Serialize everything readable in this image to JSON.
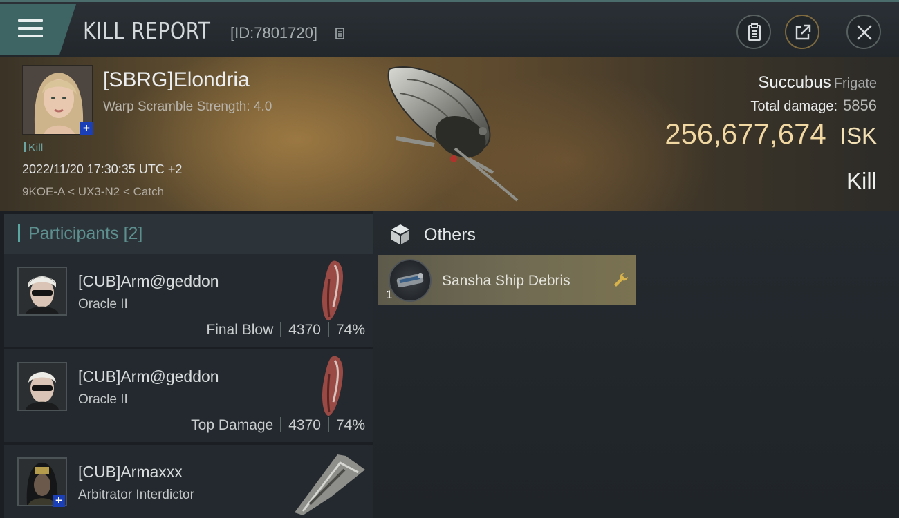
{
  "header": {
    "title": "KILL REPORT",
    "report_id": "[ID:7801720]",
    "menu_icon": "hamburger-menu-icon",
    "buttons": [
      "clipboard-icon",
      "share-icon",
      "close-icon"
    ]
  },
  "victim": {
    "name": "[SBRG]Elondria",
    "warp_scramble": "Warp Scramble Strength: 4.0",
    "kill_tag": "Kill",
    "datetime": "2022/11/20 17:30:35 UTC +2",
    "location": "9KOE-A < UX3-N2 < Catch",
    "ship_name": "Succubus",
    "ship_class": "Frigate",
    "total_damage_label": "Total damage:",
    "total_damage": "5856",
    "isk_value": "256,677,674",
    "isk_unit": "ISK",
    "result": "Kill"
  },
  "participants": {
    "label": "Participants",
    "count": "[2]",
    "rows": [
      {
        "name": "[CUB]Arm@geddon",
        "ship": "Oracle II",
        "role": "Final Blow",
        "damage": "4370",
        "percent": "74%"
      },
      {
        "name": "[CUB]Arm@geddon",
        "ship": "Oracle II",
        "role": "Top Damage",
        "damage": "4370",
        "percent": "74%"
      },
      {
        "name": "[CUB]Armaxxx",
        "ship": "Arbitrator Interdictor"
      }
    ]
  },
  "others": {
    "label": "Others",
    "items": [
      {
        "name": "Sansha Ship Debris",
        "quantity": "1"
      }
    ]
  },
  "colors": {
    "accent_teal": "#5aa6a2",
    "isk_gold": "#f1d8a2",
    "badge_blue": "#1a3fb6"
  }
}
